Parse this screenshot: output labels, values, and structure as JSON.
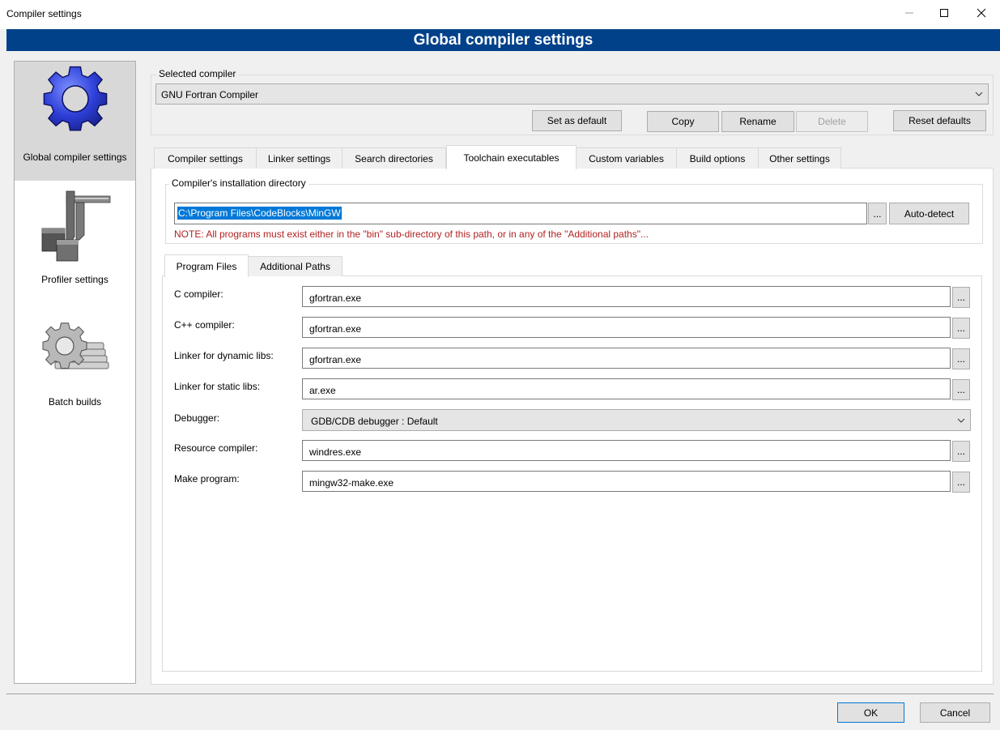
{
  "window": {
    "title": "Compiler settings"
  },
  "header": {
    "title": "Global compiler settings",
    "background": "#00418a"
  },
  "sidebar": {
    "items": [
      {
        "label": "Global compiler settings",
        "icon": "gear-icon",
        "selected": true
      },
      {
        "label": "Profiler settings",
        "icon": "caliper-icon",
        "selected": false
      },
      {
        "label": "Batch builds",
        "icon": "gear-stack-icon",
        "selected": false
      }
    ]
  },
  "selected_compiler": {
    "legend": "Selected compiler",
    "value": "GNU Fortran Compiler",
    "buttons": {
      "set_default": "Set as default",
      "copy": "Copy",
      "rename": "Rename",
      "delete": "Delete",
      "reset": "Reset defaults"
    }
  },
  "tabs": [
    {
      "label": "Compiler settings",
      "active": false
    },
    {
      "label": "Linker settings",
      "active": false
    },
    {
      "label": "Search directories",
      "active": false
    },
    {
      "label": "Toolchain executables",
      "active": true
    },
    {
      "label": "Custom variables",
      "active": false
    },
    {
      "label": "Build options",
      "active": false
    },
    {
      "label": "Other settings",
      "active": false
    }
  ],
  "install_dir": {
    "legend": "Compiler's installation directory",
    "value": "C:\\Program Files\\CodeBlocks\\MinGW",
    "browse_label": "...",
    "auto_detect_label": "Auto-detect",
    "note": "NOTE: All programs must exist either in the \"bin\" sub-directory of this path, or in any of the \"Additional paths\"..."
  },
  "subtabs": [
    {
      "label": "Program Files",
      "active": true
    },
    {
      "label": "Additional Paths",
      "active": false
    }
  ],
  "programs": {
    "c_compiler": {
      "label": "C compiler:",
      "value": "gfortran.exe"
    },
    "cpp_compiler": {
      "label": "C++ compiler:",
      "value": "gfortran.exe"
    },
    "dynamic_linker": {
      "label": "Linker for dynamic libs:",
      "value": "gfortran.exe"
    },
    "static_linker": {
      "label": "Linker for static libs:",
      "value": "ar.exe"
    },
    "debugger": {
      "label": "Debugger:",
      "value": "GDB/CDB debugger : Default"
    },
    "resource_compiler": {
      "label": "Resource compiler:",
      "value": "windres.exe"
    },
    "make_program": {
      "label": "Make program:",
      "value": "mingw32-make.exe"
    },
    "browse_label": "..."
  },
  "footer": {
    "ok": "OK",
    "cancel": "Cancel"
  }
}
